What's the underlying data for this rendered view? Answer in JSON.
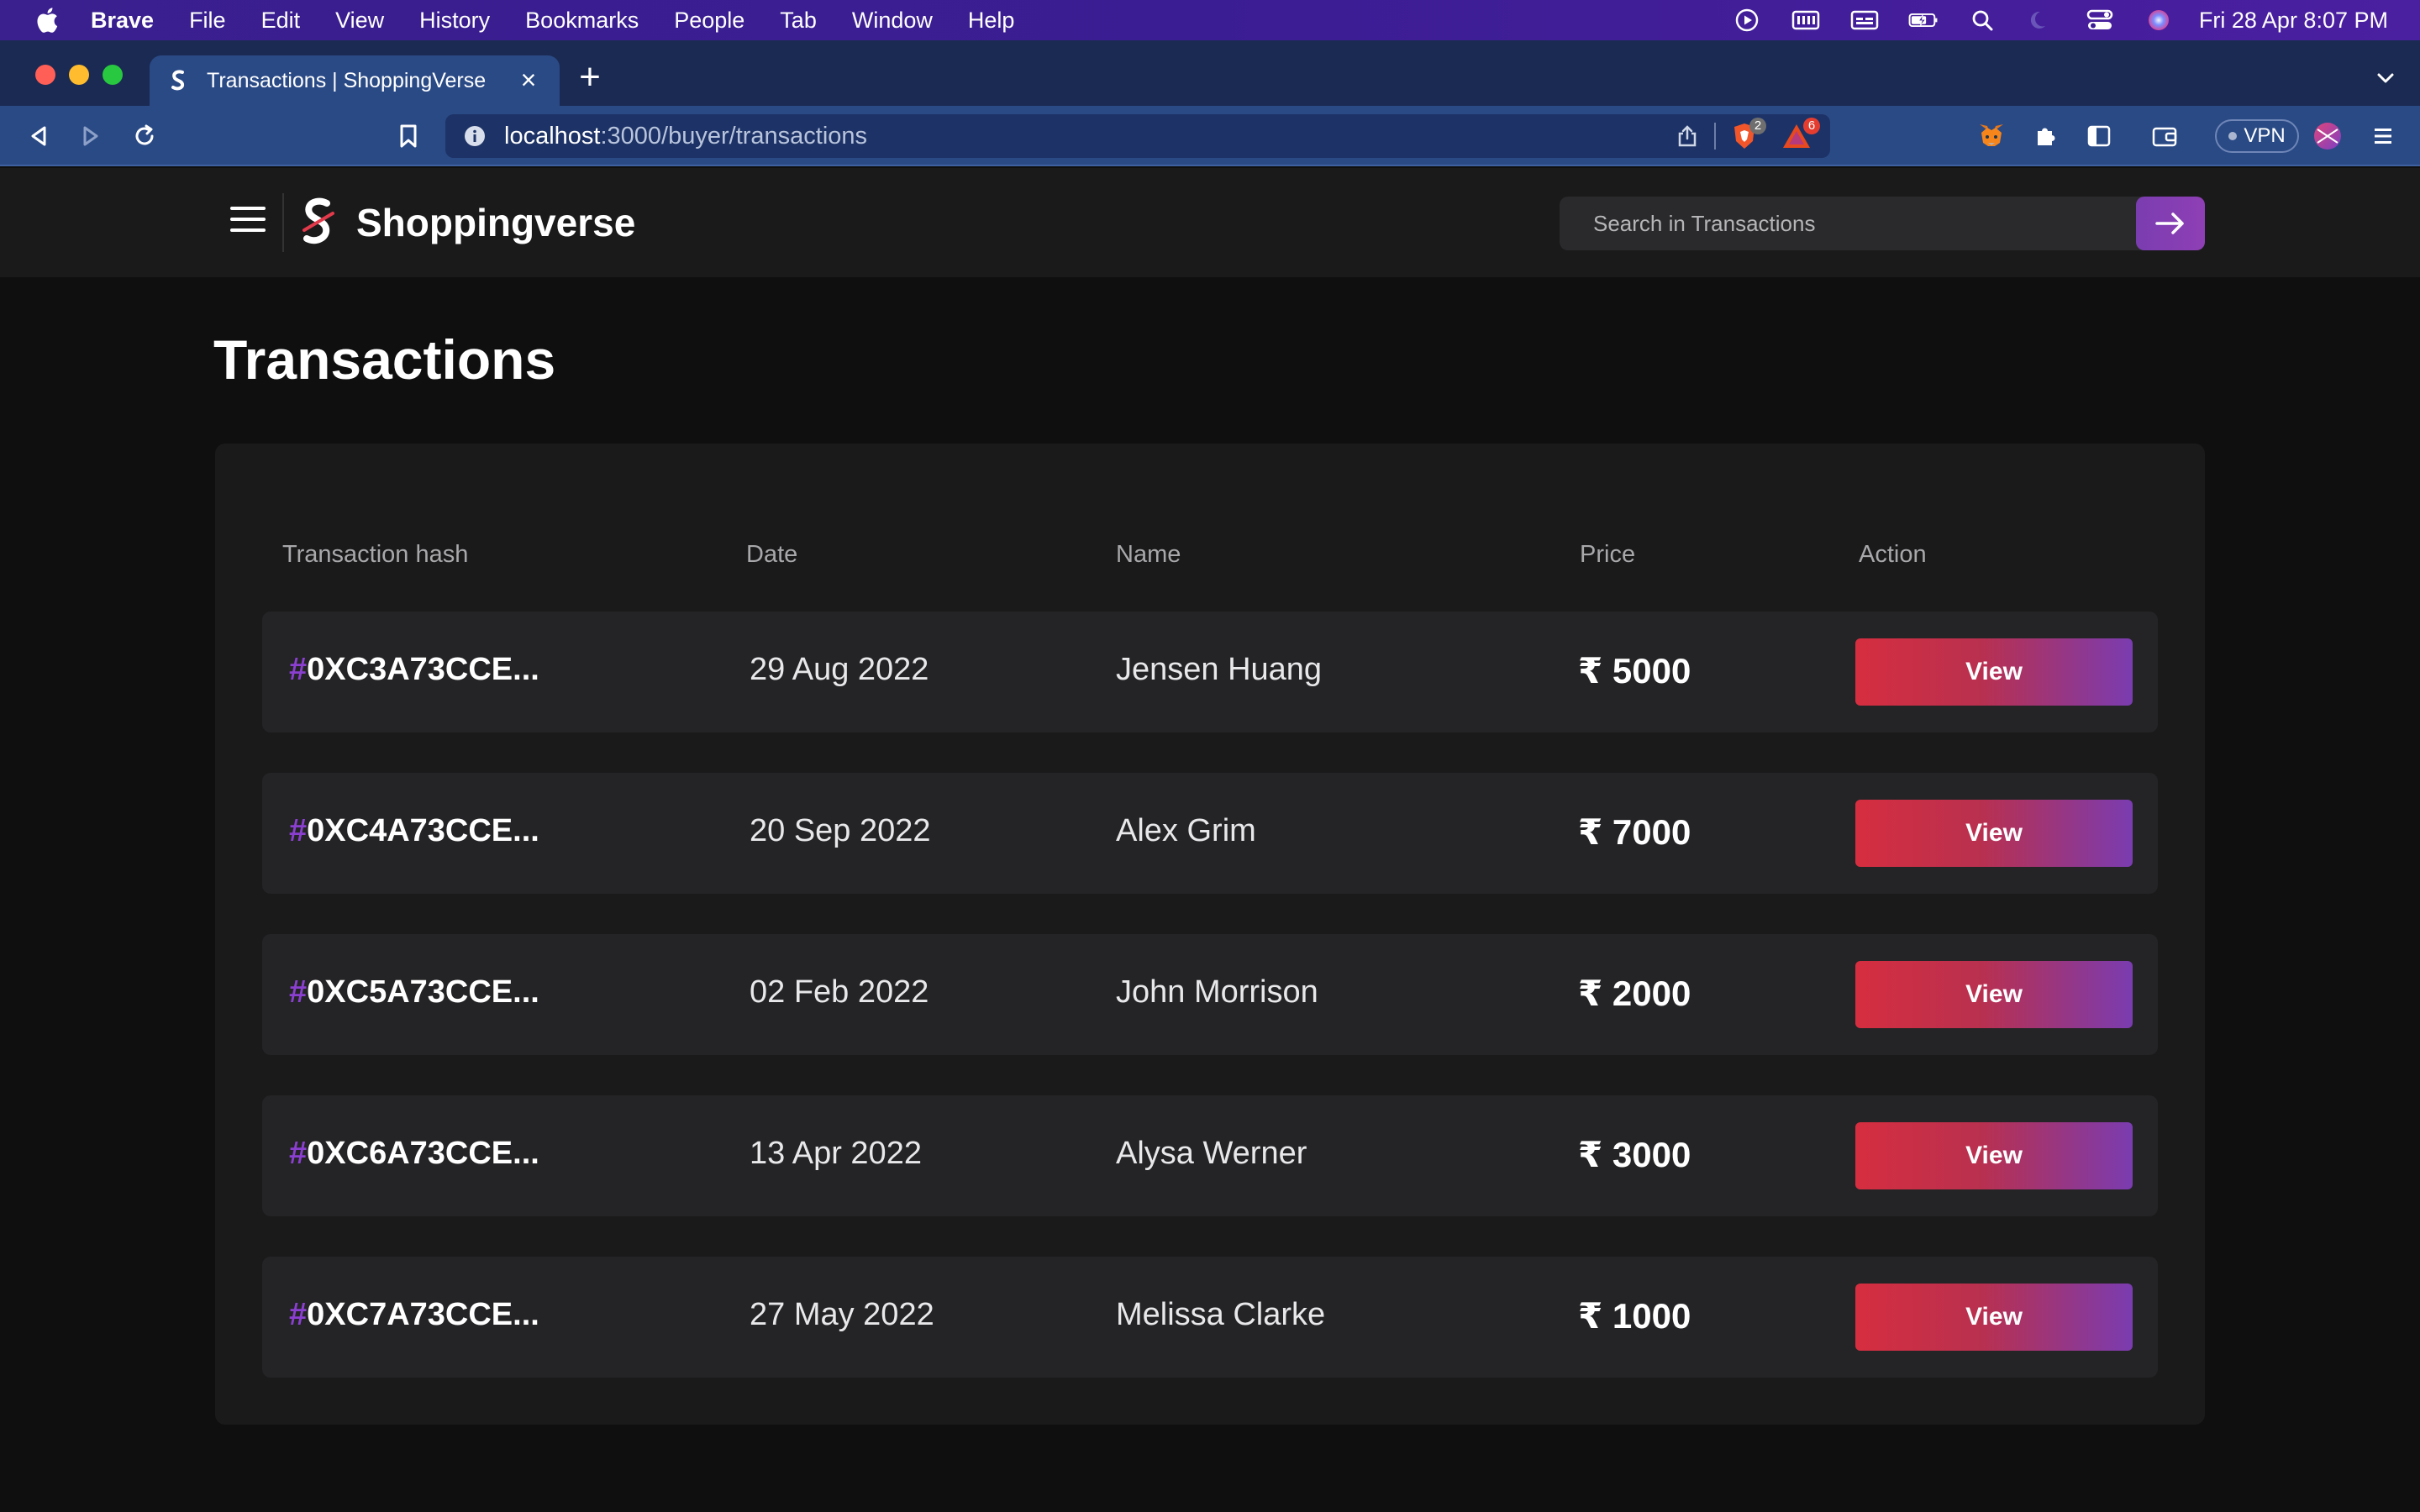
{
  "menubar": {
    "app_name": "Brave",
    "items": [
      "File",
      "Edit",
      "View",
      "History",
      "Bookmarks",
      "People",
      "Tab",
      "Window",
      "Help"
    ],
    "clock": "Fri 28 Apr  8:07 PM"
  },
  "browser": {
    "tab_title": "Transactions | ShoppingVerse",
    "url_host": "localhost",
    "url_path": ":3000/buyer/transactions",
    "shield_badge": "2",
    "rewards_badge": "6",
    "vpn_label": "VPN"
  },
  "header": {
    "brand": "Shoppingverse",
    "search_placeholder": "Search in Transactions"
  },
  "page": {
    "title": "Transactions"
  },
  "table": {
    "columns": [
      "Transaction hash",
      "Date",
      "Name",
      "Price",
      "Action"
    ],
    "rows": [
      {
        "hash_mark": "#",
        "hash": "0XC3A73CCE...",
        "date": "29 Aug 2022",
        "name": "Jensen Huang",
        "price": "₹ 5000",
        "action": "View"
      },
      {
        "hash_mark": "#",
        "hash": "0XC4A73CCE...",
        "date": "20 Sep 2022",
        "name": "Alex Grim",
        "price": "₹ 7000",
        "action": "View"
      },
      {
        "hash_mark": "#",
        "hash": "0XC5A73CCE...",
        "date": "02 Feb 2022",
        "name": "John Morrison",
        "price": "₹ 2000",
        "action": "View"
      },
      {
        "hash_mark": "#",
        "hash": "0XC6A73CCE...",
        "date": "13 Apr 2022",
        "name": "Alysa Werner",
        "price": "₹ 3000",
        "action": "View"
      },
      {
        "hash_mark": "#",
        "hash": "0XC7A73CCE...",
        "date": "27 May 2022",
        "name": "Melissa Clarke",
        "price": "₹ 1000",
        "action": "View"
      }
    ]
  },
  "colors": {
    "accent_purple": "#8b3fd1",
    "button_start": "#d62e3f",
    "button_end": "#7a3cb0",
    "background": "#0f0f10",
    "panel": "#1a1a1b",
    "row": "#242426"
  },
  "icons": [
    "apple-icon",
    "play-circle-icon",
    "memory-icon",
    "caption-icon",
    "battery-icon",
    "search-icon",
    "moon-icon",
    "control-center-icon",
    "siri-icon",
    "back-icon",
    "forward-icon",
    "reload-icon",
    "bookmark-icon",
    "info-icon",
    "share-icon",
    "brave-shield-icon",
    "rewards-icon",
    "metamask-icon",
    "extensions-icon",
    "sidebar-icon",
    "wallet-icon",
    "profile-avatar",
    "menu-icon",
    "hamburger-icon",
    "arrow-right-icon"
  ]
}
